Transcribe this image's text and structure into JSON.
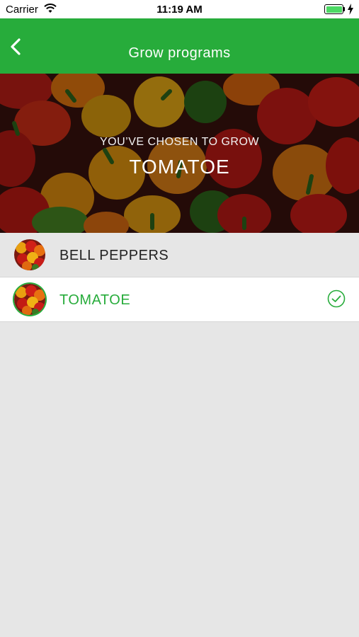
{
  "status_bar": {
    "carrier": "Carrier",
    "time": "11:19 AM",
    "battery_level": 1.0
  },
  "nav": {
    "title": "Grow programs",
    "back_icon": "chevron-left-icon"
  },
  "hero": {
    "subtitle": "YOU’VE CHOSEN TO GROW",
    "title": "TOMATOE"
  },
  "programs": [
    {
      "label": "BELL PEPPERS",
      "selected": false
    },
    {
      "label": "TOMATOE",
      "selected": true
    }
  ],
  "colors": {
    "accent": "#27ac3b",
    "background": "#e6e6e6",
    "selected_row": "#ffffff"
  }
}
